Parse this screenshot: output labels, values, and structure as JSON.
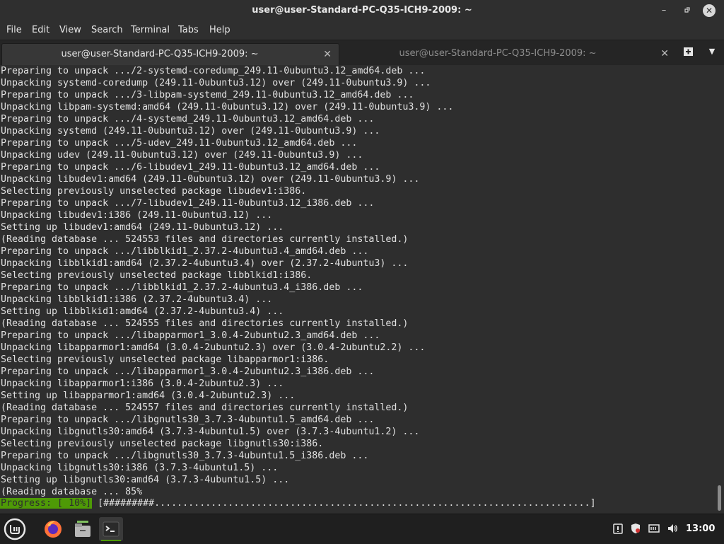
{
  "window": {
    "title": "user@user-Standard-PC-Q35-ICH9-2009: ~",
    "minimize_icon": "minimize-icon",
    "restore_icon": "restore-icon",
    "close_icon": "close-icon"
  },
  "menu": [
    "File",
    "Edit",
    "View",
    "Search",
    "Terminal",
    "Tabs",
    "Help"
  ],
  "tabs": [
    {
      "label": "user@user-Standard-PC-Q35-ICH9-2009: ~",
      "active": true
    },
    {
      "label": "user@user-Standard-PC-Q35-ICH9-2009: ~",
      "active": false
    }
  ],
  "terminal": {
    "lines": [
      "Preparing to unpack .../2-systemd-coredump_249.11-0ubuntu3.12_amd64.deb ...",
      "Unpacking systemd-coredump (249.11-0ubuntu3.12) over (249.11-0ubuntu3.9) ...",
      "Preparing to unpack .../3-libpam-systemd_249.11-0ubuntu3.12_amd64.deb ...",
      "Unpacking libpam-systemd:amd64 (249.11-0ubuntu3.12) over (249.11-0ubuntu3.9) ...",
      "Preparing to unpack .../4-systemd_249.11-0ubuntu3.12_amd64.deb ...",
      "Unpacking systemd (249.11-0ubuntu3.12) over (249.11-0ubuntu3.9) ...",
      "Preparing to unpack .../5-udev_249.11-0ubuntu3.12_amd64.deb ...",
      "Unpacking udev (249.11-0ubuntu3.12) over (249.11-0ubuntu3.9) ...",
      "Preparing to unpack .../6-libudev1_249.11-0ubuntu3.12_amd64.deb ...",
      "Unpacking libudev1:amd64 (249.11-0ubuntu3.12) over (249.11-0ubuntu3.9) ...",
      "Selecting previously unselected package libudev1:i386.",
      "Preparing to unpack .../7-libudev1_249.11-0ubuntu3.12_i386.deb ...",
      "Unpacking libudev1:i386 (249.11-0ubuntu3.12) ...",
      "Setting up libudev1:amd64 (249.11-0ubuntu3.12) ...",
      "(Reading database ... 524553 files and directories currently installed.)",
      "Preparing to unpack .../libblkid1_2.37.2-4ubuntu3.4_amd64.deb ...",
      "Unpacking libblkid1:amd64 (2.37.2-4ubuntu3.4) over (2.37.2-4ubuntu3) ...",
      "Selecting previously unselected package libblkid1:i386.",
      "Preparing to unpack .../libblkid1_2.37.2-4ubuntu3.4_i386.deb ...",
      "Unpacking libblkid1:i386 (2.37.2-4ubuntu3.4) ...",
      "Setting up libblkid1:amd64 (2.37.2-4ubuntu3.4) ...",
      "(Reading database ... 524555 files and directories currently installed.)",
      "Preparing to unpack .../libapparmor1_3.0.4-2ubuntu2.3_amd64.deb ...",
      "Unpacking libapparmor1:amd64 (3.0.4-2ubuntu2.3) over (3.0.4-2ubuntu2.2) ...",
      "Selecting previously unselected package libapparmor1:i386.",
      "Preparing to unpack .../libapparmor1_3.0.4-2ubuntu2.3_i386.deb ...",
      "Unpacking libapparmor1:i386 (3.0.4-2ubuntu2.3) ...",
      "Setting up libapparmor1:amd64 (3.0.4-2ubuntu2.3) ...",
      "(Reading database ... 524557 files and directories currently installed.)",
      "Preparing to unpack .../libgnutls30_3.7.3-4ubuntu1.5_amd64.deb ...",
      "Unpacking libgnutls30:amd64 (3.7.3-4ubuntu1.5) over (3.7.3-4ubuntu1.2) ...",
      "Selecting previously unselected package libgnutls30:i386.",
      "Preparing to unpack .../libgnutls30_3.7.3-4ubuntu1.5_i386.deb ...",
      "Unpacking libgnutls30:i386 (3.7.3-4ubuntu1.5) ...",
      "Setting up libgnutls30:amd64 (3.7.3-4ubuntu1.5) ...",
      "(Reading database ... 85%"
    ],
    "progress_label": "Progress: [ 10%]",
    "progress_bar": " [#########.............................................................................] ",
    "progress_fraction": 0.1
  },
  "taskbar": {
    "items": [
      {
        "name": "mint-menu-icon"
      },
      {
        "name": "firefox-icon"
      },
      {
        "name": "file-manager-icon"
      },
      {
        "name": "terminal-icon"
      }
    ],
    "tray": [
      "update-manager-icon",
      "shield-icon",
      "network-icon",
      "volume-icon"
    ],
    "clock": "13:00"
  },
  "colors": {
    "background": "#2e2e2e",
    "text": "#e0e0e0",
    "progress_label_bg": "#4e9a06",
    "taskbar_bg": "#1f1f1f"
  }
}
